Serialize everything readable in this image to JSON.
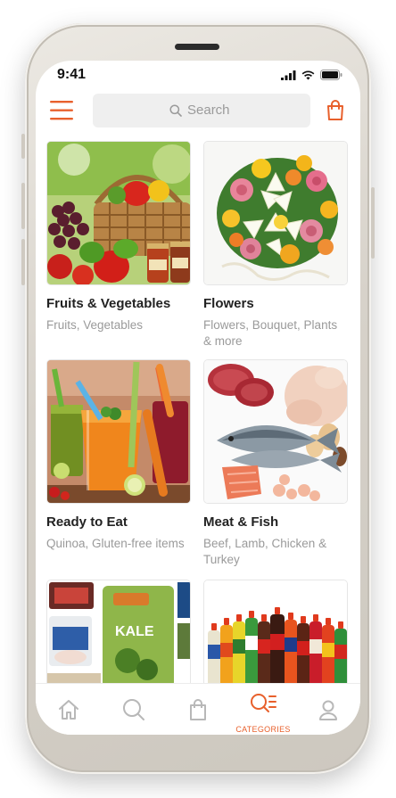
{
  "status_bar": {
    "time": "9:41"
  },
  "header": {
    "search_placeholder": "Search"
  },
  "categories": [
    {
      "title": "Fruits & Vegetables",
      "subtitle": "Fruits, Vegetables"
    },
    {
      "title": "Flowers",
      "subtitle": "Flowers, Bouquet, Plants & more"
    },
    {
      "title": "Ready to Eat",
      "subtitle": "Quinoa, Gluten-free items"
    },
    {
      "title": "Meat & Fish",
      "subtitle": "Beef, Lamb, Chicken & Turkey"
    }
  ],
  "tab_bar": {
    "tabs": [
      {
        "icon": "home-icon"
      },
      {
        "icon": "search-icon"
      },
      {
        "icon": "bag-icon"
      },
      {
        "icon": "categories-icon",
        "label": "CATEGORIES",
        "active": true
      },
      {
        "icon": "profile-icon"
      }
    ]
  },
  "colors": {
    "accent": "#e8602c",
    "muted": "#9a9a9a",
    "text": "#222222"
  }
}
